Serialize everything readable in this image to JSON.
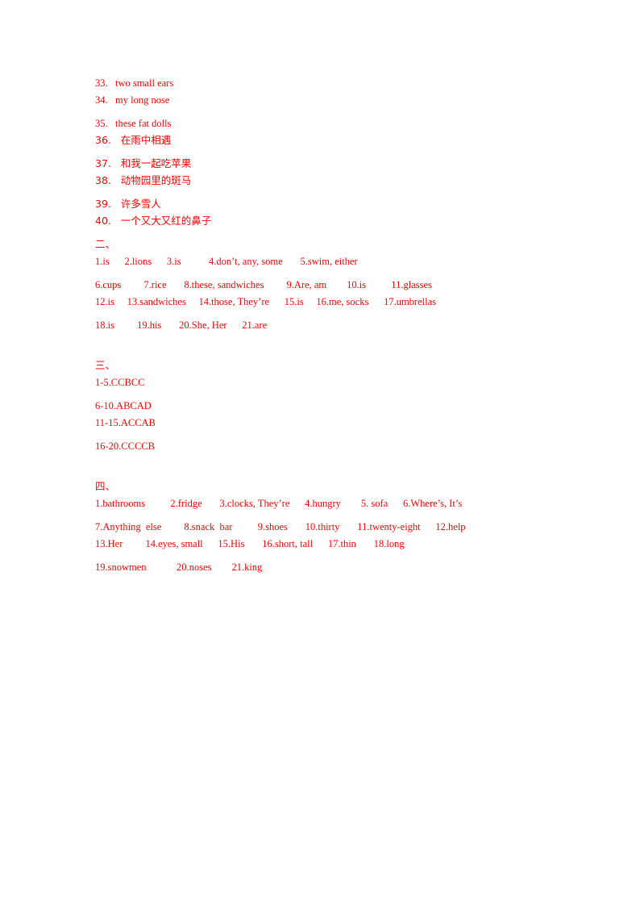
{
  "document": {
    "text_color": "#ff0000",
    "background_color": "#ffffff",
    "translation_section": {
      "items": [
        {
          "number": "33.",
          "answer": "two small ears"
        },
        {
          "number": "34.",
          "answer": "my long nose"
        },
        {
          "number": "35.",
          "answer": "these fat dolls"
        },
        {
          "number": "36.",
          "answer": "在雨中相遇"
        },
        {
          "number": "37.",
          "answer": "和我一起吃苹果"
        },
        {
          "number": "38.",
          "answer": "动物园里的斑马"
        },
        {
          "number": "39.",
          "answer": "许多雪人"
        },
        {
          "number": "40.",
          "answer": "一个又大又红的鼻子"
        }
      ],
      "line_33": "33.   two small ears",
      "line_34": "34.   my long nose",
      "line_35": "35.   these fat dolls",
      "line_36": "36.   在雨中相遇",
      "line_37": "37.   和我一起吃苹果",
      "line_38": "38.   动物园里的斑马",
      "line_39": "39.   许多雪人",
      "line_40": "40.   一个又大又红的鼻子"
    },
    "section_two": {
      "heading": "二、",
      "lines": [
        "1.is      2.lions      3.is           4.don’t, any, some       5.swim, either",
        "6.cups         7.rice       8.these, sandwiches         9.Are, am        10.is          11.glasses",
        "12.is     13.sandwiches     14.those, They’re      15.is     16.me, socks      17.umbrellas",
        "18.is         19.his       20.She, Her      21.are"
      ],
      "answers": [
        {
          "n": "1",
          "a": "is"
        },
        {
          "n": "2",
          "a": "lions"
        },
        {
          "n": "3",
          "a": "is"
        },
        {
          "n": "4",
          "a": "don’t, any, some"
        },
        {
          "n": "5",
          "a": "swim, either"
        },
        {
          "n": "6",
          "a": "cups"
        },
        {
          "n": "7",
          "a": "rice"
        },
        {
          "n": "8",
          "a": "these, sandwiches"
        },
        {
          "n": "9",
          "a": "Are, am"
        },
        {
          "n": "10",
          "a": "is"
        },
        {
          "n": "11",
          "a": "glasses"
        },
        {
          "n": "12",
          "a": "is"
        },
        {
          "n": "13",
          "a": "sandwiches"
        },
        {
          "n": "14",
          "a": "those, They’re"
        },
        {
          "n": "15",
          "a": "is"
        },
        {
          "n": "16",
          "a": "me, socks"
        },
        {
          "n": "17",
          "a": "umbrellas"
        },
        {
          "n": "18",
          "a": "is"
        },
        {
          "n": "19",
          "a": "his"
        },
        {
          "n": "20",
          "a": "She, Her"
        },
        {
          "n": "21",
          "a": "are"
        }
      ]
    },
    "section_three": {
      "heading": "三、",
      "lines": [
        "1-5.CCBCC",
        "6-10.ABCAD",
        "11-15.ACCAB",
        "16-20.CCCCB"
      ],
      "answers": [
        {
          "range": "1-5",
          "letters": "CCBCC"
        },
        {
          "range": "6-10",
          "letters": "ABCAD"
        },
        {
          "range": "11-15",
          "letters": "ACCAB"
        },
        {
          "range": "16-20",
          "letters": "CCCCB"
        }
      ]
    },
    "section_four": {
      "heading": "四、",
      "lines": [
        "1.bathrooms          2.fridge       3.clocks, They’re      4.hungry        5. sofa      6.Where’s, It’s",
        "7.Anything  else         8.snack  bar          9.shoes       10.thirty       11.twenty-eight      12.help",
        "13.Her         14.eyes, small      15.His       16.short, tall      17.thin       18.long",
        "19.snowmen            20.noses        21.king"
      ],
      "answers": [
        {
          "n": "1",
          "a": "bathrooms"
        },
        {
          "n": "2",
          "a": "fridge"
        },
        {
          "n": "3",
          "a": "clocks, They’re"
        },
        {
          "n": "4",
          "a": "hungry"
        },
        {
          "n": "5",
          "a": "sofa"
        },
        {
          "n": "6",
          "a": "Where’s, It’s"
        },
        {
          "n": "7",
          "a": "Anything else"
        },
        {
          "n": "8",
          "a": "snack bar"
        },
        {
          "n": "9",
          "a": "shoes"
        },
        {
          "n": "10",
          "a": "thirty"
        },
        {
          "n": "11",
          "a": "twenty-eight"
        },
        {
          "n": "12",
          "a": "help"
        },
        {
          "n": "13",
          "a": "Her"
        },
        {
          "n": "14",
          "a": "eyes, small"
        },
        {
          "n": "15",
          "a": "His"
        },
        {
          "n": "16",
          "a": "short, tall"
        },
        {
          "n": "17",
          "a": "thin"
        },
        {
          "n": "18",
          "a": "long"
        },
        {
          "n": "19",
          "a": "snowmen"
        },
        {
          "n": "20",
          "a": "noses"
        },
        {
          "n": "21",
          "a": "king"
        }
      ]
    }
  }
}
